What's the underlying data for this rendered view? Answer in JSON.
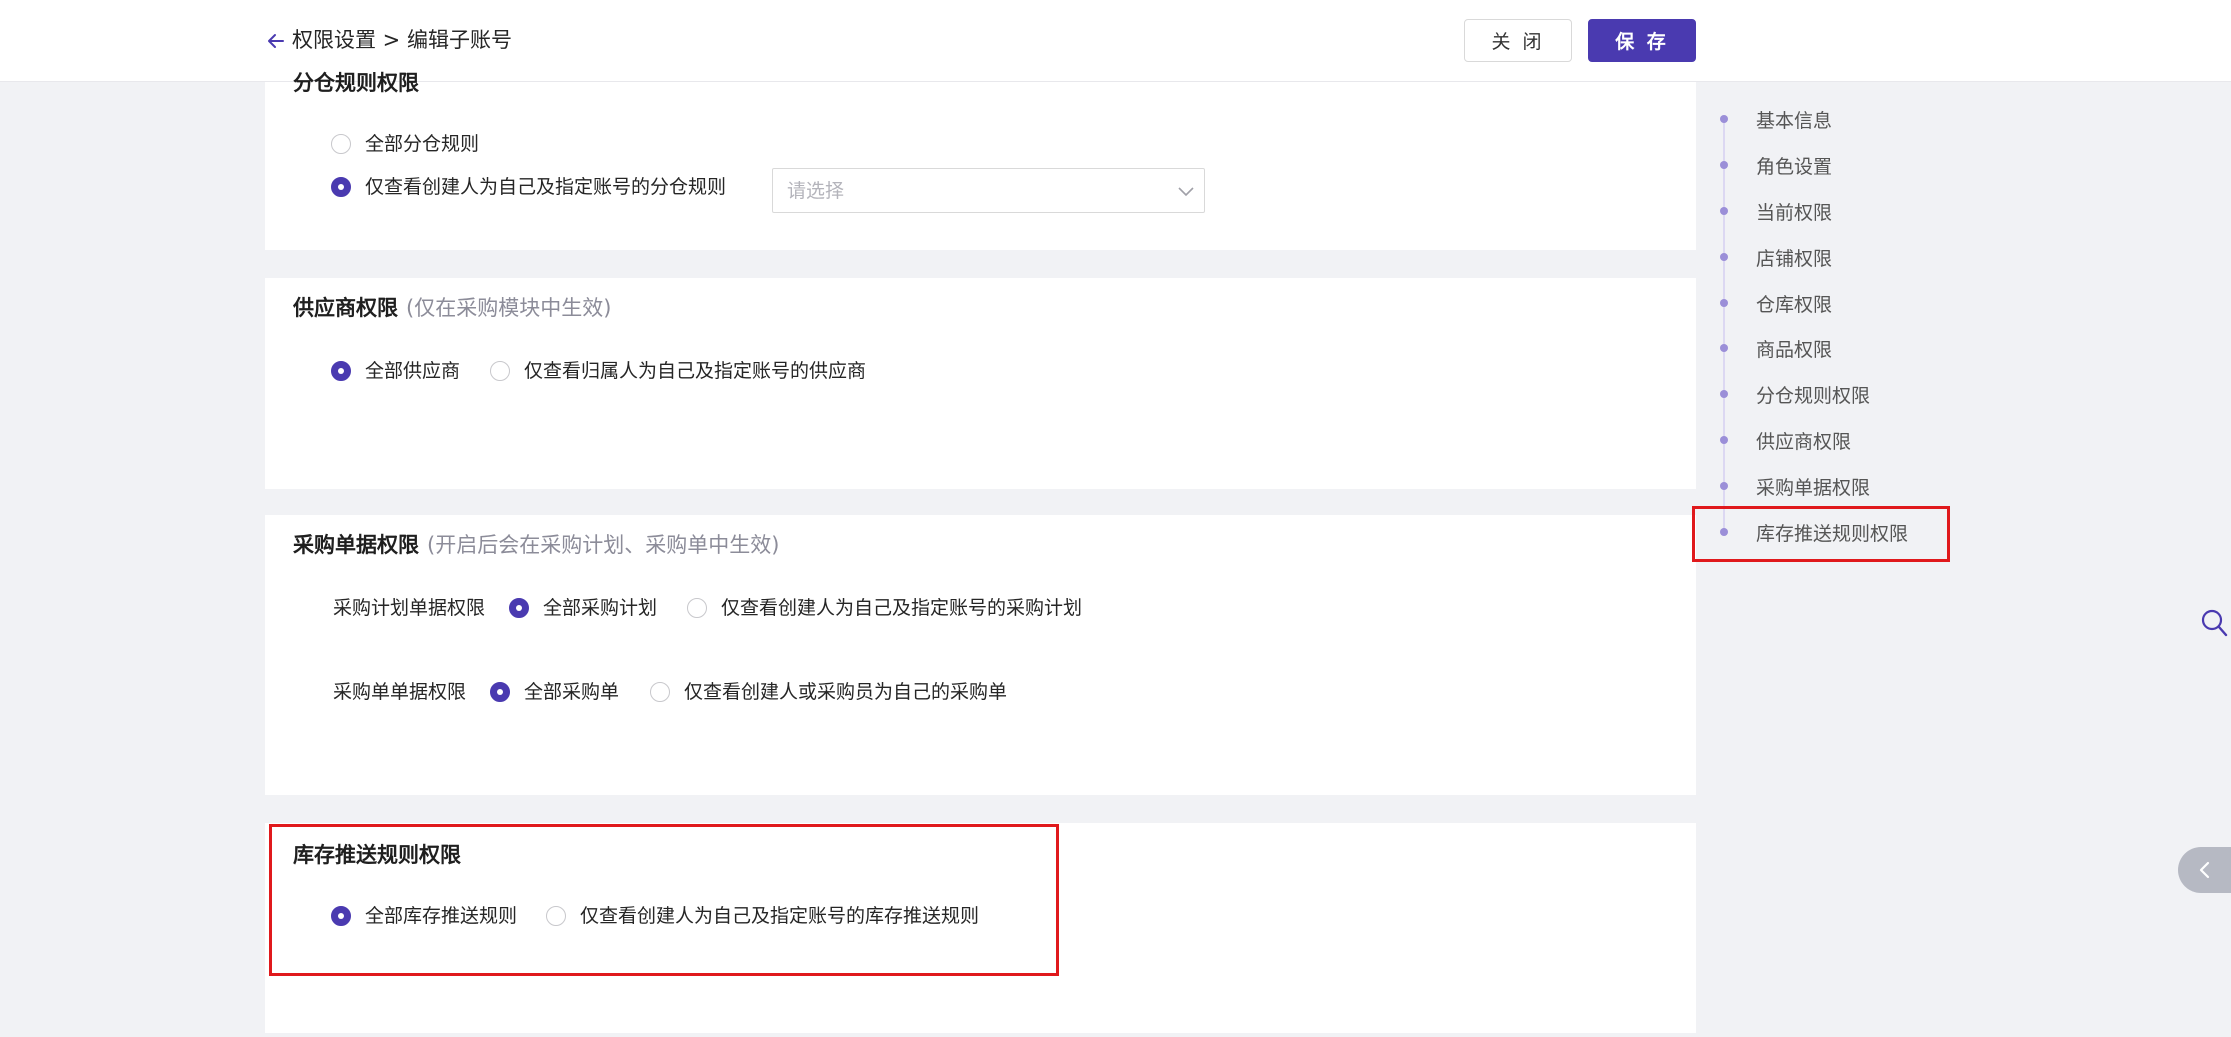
{
  "header": {
    "breadcrumb": "权限设置 > 编辑子账号",
    "close_label": "关 闭",
    "save_label": "保 存"
  },
  "sections": {
    "fencang": {
      "title": "分仓规则权限",
      "options": [
        "全部分仓规则",
        "仅查看创建人为自己及指定账号的分仓规则"
      ],
      "selected_index": 1,
      "select_placeholder": "请选择"
    },
    "supplier": {
      "title": "供应商权限",
      "note": "(仅在采购模块中生效)",
      "options": [
        "全部供应商",
        "仅查看归属人为自己及指定账号的供应商"
      ],
      "selected_index": 0
    },
    "purchase_doc": {
      "title": "采购单据权限",
      "note": "(开启后会在采购计划、采购单中生效)",
      "rows": [
        {
          "label": "采购计划单据权限",
          "options": [
            "全部采购计划",
            "仅查看创建人为自己及指定账号的采购计划"
          ],
          "selected_index": 0
        },
        {
          "label": "采购单单据权限",
          "options": [
            "全部采购单",
            "仅查看创建人或采购员为自己的采购单"
          ],
          "selected_index": 0
        }
      ]
    },
    "stock_push": {
      "title": "库存推送规则权限",
      "options": [
        "全部库存推送规则",
        "仅查看创建人为自己及指定账号的库存推送规则"
      ],
      "selected_index": 0
    }
  },
  "anchor_nav": {
    "items": [
      "基本信息",
      "角色设置",
      "当前权限",
      "店铺权限",
      "仓库权限",
      "商品权限",
      "分仓规则权限",
      "供应商权限",
      "采购单据权限",
      "库存推送规则权限"
    ]
  },
  "colors": {
    "primary": "#4a3ab0",
    "highlight": "#e0191c",
    "anchor_dot": "#9b8fd8"
  },
  "icons": [
    "arrow-left-icon",
    "chevron-down-icon",
    "search-icon",
    "chevron-left-icon"
  ]
}
